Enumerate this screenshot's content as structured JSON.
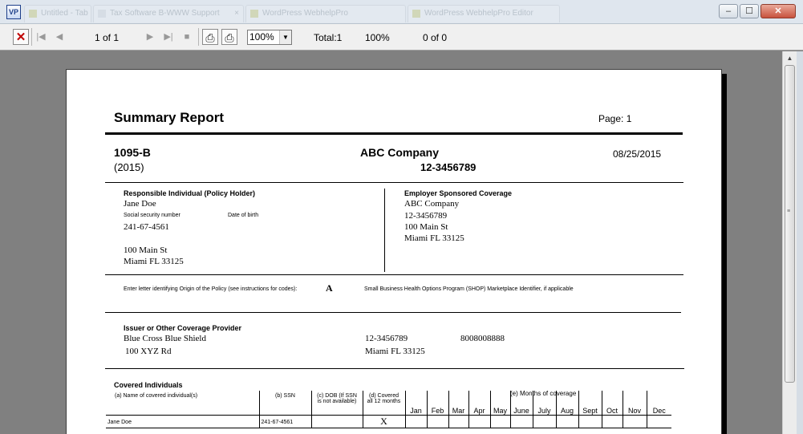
{
  "browser": {
    "ghost_tabs": [
      "Untitled - Tab 1",
      "Tax Software B-WWW Support",
      "WordPress WebhelpPro",
      "WordPress WebhelpPro Editor"
    ],
    "window_buttons": {
      "minimize": "–",
      "maximize": "☐",
      "close": "✕"
    }
  },
  "toolbar": {
    "stop_glyph": "✕",
    "first_glyph": "|◀",
    "prev_glyph": "◀",
    "page_indicator": "1 of 1",
    "next_glyph": "▶",
    "last_glyph": "▶|",
    "stop_square_glyph": "■",
    "print_glyph": "⎙",
    "print_setup_glyph": "⎙",
    "zoom_value": "100%",
    "zoom_arrow": "▼",
    "total": "Total:1",
    "percent": "100%",
    "match": "0 of 0"
  },
  "scrollbar": {
    "up_glyph": "▲"
  },
  "report": {
    "title": "Summary Report",
    "page_label": "Page:  1",
    "form_name": "1095-B",
    "form_year": "(2015)",
    "company_name": "ABC Company",
    "company_ein": "12-3456789",
    "date": "08/25/2015",
    "responsible": {
      "heading": "Responsible Individual (Policy Holder)",
      "name": "Jane  Doe",
      "ssn_label": "Social security number",
      "dob_label": "Date of birth",
      "ssn": "241-67-4561",
      "address1": "100 Main St",
      "address2": "Miami FL  33125"
    },
    "employer": {
      "heading": "Employer Sponsored Coverage",
      "name": "ABC Company",
      "ein": "12-3456789",
      "address1": "100 Main St",
      "address2": "Miami FL  33125"
    },
    "origin": {
      "label": "Enter letter identifying Origin of the Policy (see instructions for codes):",
      "code": "A",
      "shop_label": "Small Business Health Options Program (SHOP) Marketplace Identifier, if applicable"
    },
    "issuer": {
      "heading": "Issuer or Other Coverage Provider",
      "name": "Blue Cross Blue Shield",
      "address1": "100 XYZ Rd",
      "ein": "12-3456789",
      "phone": "8008008888",
      "city": "Miami FL  33125"
    },
    "covered": {
      "heading": "Covered Individuals",
      "col_name": "(a) Name of covered individual(s)",
      "col_ssn": "(b) SSN",
      "col_dob_1": "(c) DOB (If SSN",
      "col_dob_2": "is not available)",
      "col_all12_1": "(d) Covered",
      "col_all12_2": "all 12 months",
      "months_heading": "(e) Months of coverage",
      "months": [
        "Jan",
        "Feb",
        "Mar",
        "Apr",
        "May",
        "June",
        "July",
        "Aug",
        "Sept",
        "Oct",
        "Nov",
        "Dec"
      ],
      "rows": [
        {
          "name": "Jane Doe",
          "ssn": "241-67-4561",
          "dob": "",
          "all12": "X"
        }
      ]
    }
  }
}
